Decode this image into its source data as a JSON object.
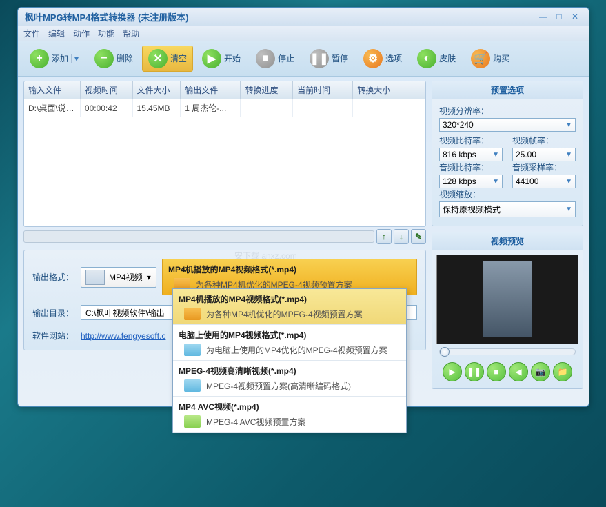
{
  "title": "枫叶MPG转MP4格式转换器    (未注册版本)",
  "menu": [
    "文件",
    "编辑",
    "动作",
    "功能",
    "帮助"
  ],
  "toolbar": {
    "add": "添加",
    "del": "删除",
    "clear": "清空",
    "start": "开始",
    "stop": "停止",
    "pause": "暂停",
    "options": "选项",
    "skin": "皮肤",
    "buy": "购买"
  },
  "table": {
    "headers": [
      "输入文件",
      "视频时间",
      "文件大小",
      "输出文件",
      "转换进度",
      "当前时间",
      "转换大小"
    ],
    "row": [
      "D:\\桌面\\说明...",
      "00:00:42",
      "15.45MB",
      "1 周杰伦-...",
      "",
      "",
      ""
    ]
  },
  "output": {
    "format_label": "输出格式：",
    "format_value": "MP4视频",
    "dir_label": "输出目录：",
    "dir_value": "C:\\枫叶视频软件\\输出",
    "site_label": "软件网站：",
    "site_url": "http://www.fengyesoft.c"
  },
  "selected_format": {
    "title": "MP4机播放的MP4视频格式(*.mp4)",
    "desc": "为各种MP4机优化的MPEG-4视频预置方案"
  },
  "dropdown_items": [
    {
      "title": "MP4机播放的MP4视频格式(*.mp4)",
      "desc": "为各种MP4机优化的MPEG-4视频预置方案",
      "folder": "orange",
      "cls": "hover"
    },
    {
      "title": "电脑上使用的MP4视频格式(*.mp4)",
      "desc": "为电脑上使用的MP4优化的MPEG-4视频预置方案",
      "folder": "blue",
      "cls": ""
    },
    {
      "title": "MPEG-4视频高清晰视频(*.mp4)",
      "desc": "MPEG-4视频预置方案(高清晰编码格式)",
      "folder": "blue",
      "cls": ""
    },
    {
      "title": "MP4 AVC视频(*.mp4)",
      "desc": "MPEG-4 AVC视频预置方案",
      "folder": "green",
      "cls": ""
    }
  ],
  "preset": {
    "title": "预置选项",
    "res_label": "视频分辨率：",
    "res_value": "320*240",
    "vbr_label": "视频比特率：",
    "vbr_value": "816 kbps",
    "fps_label": "视频帧率：",
    "fps_value": "25.00",
    "abr_label": "音频比特率：",
    "abr_value": "128 kbps",
    "asr_label": "音频采样率：",
    "asr_value": "44100",
    "scale_label": "视频缩放：",
    "scale_value": "保持原视频模式"
  },
  "preview": {
    "title": "视频预览"
  },
  "watermark": "安下载\nanxz.com"
}
